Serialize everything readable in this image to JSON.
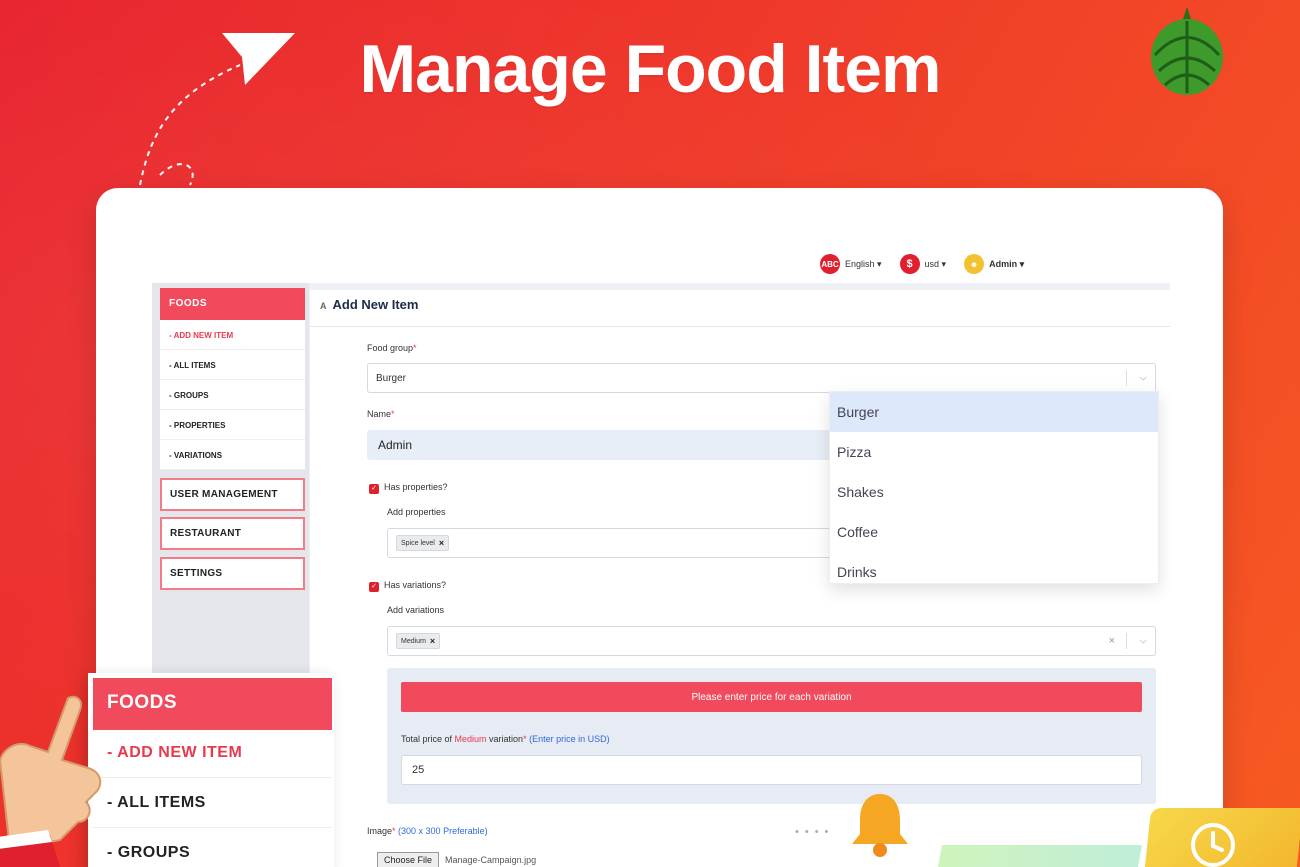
{
  "hero": {
    "title": "Manage Food Item"
  },
  "topbar": {
    "language": {
      "badge": "ABC",
      "label": "English ▾"
    },
    "currency": {
      "badge": "$",
      "label": "usd ▾"
    },
    "user": {
      "label": "Admin ▾"
    }
  },
  "sidebar": {
    "section": "FOODS",
    "items": [
      {
        "label": "- ADD NEW ITEM"
      },
      {
        "label": "- ALL ITEMS"
      },
      {
        "label": "- GROUPS"
      },
      {
        "label": "- PROPERTIES"
      },
      {
        "label": "- VARIATIONS"
      }
    ],
    "groups": [
      {
        "label": "USER MANAGEMENT"
      },
      {
        "label": "RESTAURANT"
      },
      {
        "label": "SETTINGS"
      }
    ]
  },
  "main": {
    "title_prefix": "A",
    "title": "Add New Item",
    "food_group": {
      "label": "Food group",
      "required": "*",
      "value": "Burger"
    },
    "name": {
      "label": "Name",
      "required": "*",
      "value": "Admin"
    },
    "has_properties": {
      "label": "Has properties?",
      "checked": true
    },
    "add_properties": {
      "label": "Add properties",
      "tags": [
        "Spice level"
      ]
    },
    "has_variations": {
      "label": "Has variations?",
      "checked": true
    },
    "add_variations": {
      "label": "Add variations",
      "tags": [
        "Medium"
      ]
    },
    "variation_banner": "Please enter price for each variation",
    "price": {
      "label_a": "Total price of ",
      "label_variation": "Medium",
      "label_b": " variation",
      "required": "*",
      "hint": " (Enter price in USD)",
      "value": "25"
    },
    "image": {
      "label": "Image",
      "required": "*",
      "hint": " (300 x 300 Preferable)",
      "button": "Choose File",
      "filename": "Manage-Campaign.jpg"
    }
  },
  "dropdown": {
    "options": [
      "Burger",
      "Pizza",
      "Shakes",
      "Coffee",
      "Drinks"
    ],
    "selected": "Burger"
  },
  "zoom": {
    "section": "FOODS",
    "items": [
      {
        "label": "- ADD NEW ITEM"
      },
      {
        "label": "- ALL ITEMS"
      },
      {
        "label": "- GROUPS"
      }
    ]
  },
  "colors": {
    "accent": "#f04a5c",
    "danger": "#e83a4f",
    "link": "#2f6bd8",
    "bg_start": "#e8242f",
    "bg_end": "#f75a22"
  },
  "icons": {
    "arrow": "paper-plane-icon",
    "artichoke": "artichoke-icon",
    "hand": "pointing-hand-icon",
    "bell": "bell-icon",
    "clock": "clock-icon"
  }
}
